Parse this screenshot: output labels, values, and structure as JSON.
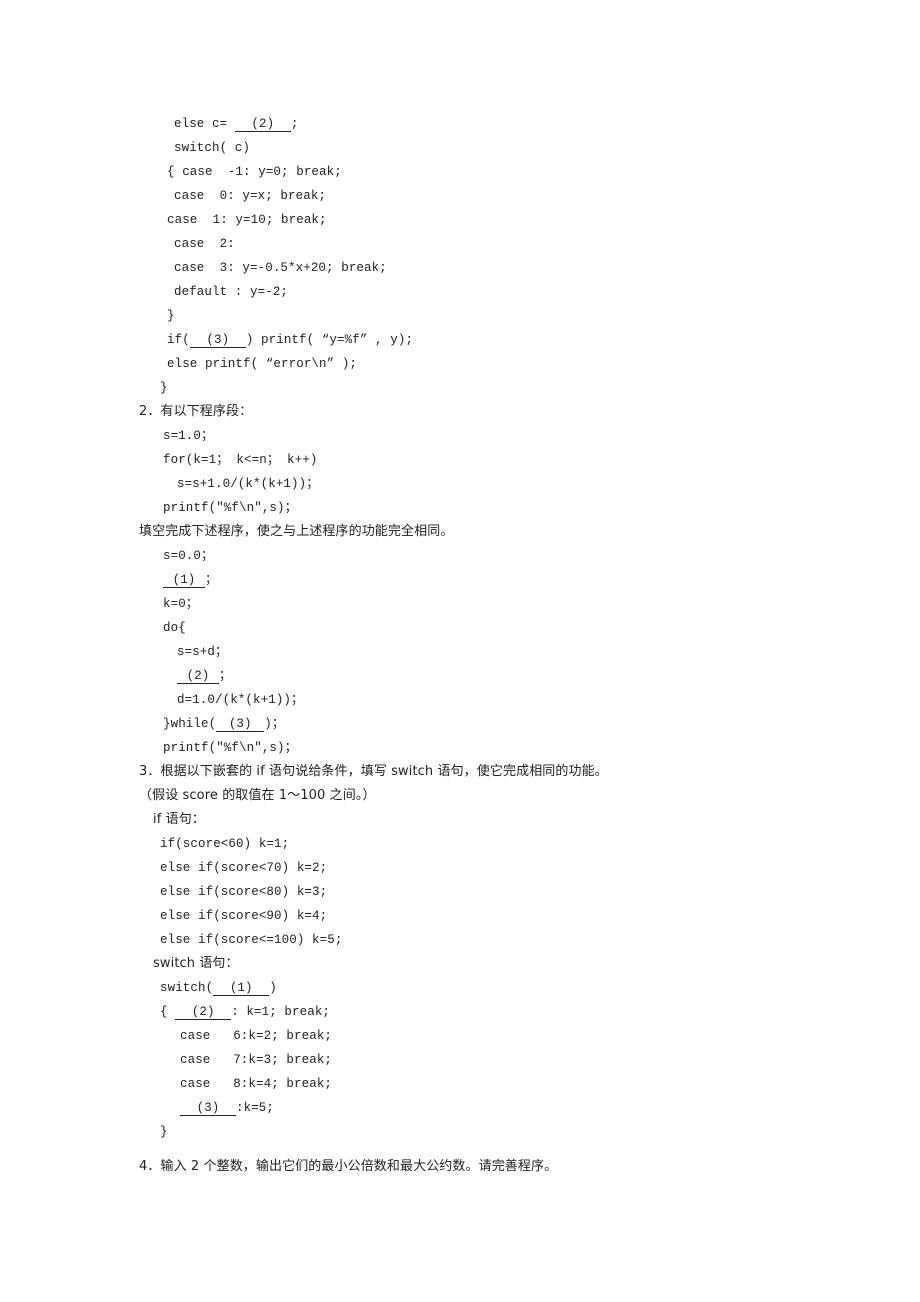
{
  "q1_tail": {
    "l1_pre": "else c= ",
    "l1_blank": "(2)",
    "l1_post": ";",
    "l2": "switch( c)",
    "l3": "{ case  -1: y=0; break;",
    "l4": "case  0: y=x; break;",
    "l5": "case  1: y=10; break;",
    "l6": "case  2:",
    "l7": "case  3: y=-0.5*x+20; break;",
    "l8": "default : y=-2;",
    "l9": "}",
    "l10_pre": "if(",
    "l10_blank": "(3)",
    "l10_post": ") printf( “y=%f” , y);",
    "l11": "else printf( “error\\n” );",
    "l12": "}"
  },
  "q2": {
    "title": "2．有以下程序段：",
    "orig": [
      "s=1.0；",
      "for(k=1； k<=n； k++)",
      "s=s+1.0/(k*(k+1))；",
      "printf(\"%f\\n\",s)；"
    ],
    "instruction": "填空完成下述程序，使之与上述程序的功能完全相同。",
    "s0": "s=0.0；",
    "b1": "(1)",
    "semi": "；",
    "k0": "k=0；",
    "do": "do{",
    "ssd": "s=s+d；",
    "b2": "(2)",
    "dline": "d=1.0/(k*(k+1))；",
    "while_pre": "}while(",
    "b3": "(3)",
    "while_post": ")；",
    "printf": "printf(\"%f\\n\",s)；"
  },
  "q3": {
    "title": "3．根据以下嵌套的 if 语句说给条件，填写 switch 语句，使它完成相同的功能。",
    "note": "（假设 score 的取值在 1～100 之间。）",
    "if_label": "if 语句：",
    "if_lines": [
      "if(score<60) k=1;",
      "else if(score<70) k=2;",
      "else if(score<80) k=3;",
      "else if(score<90) k=4;",
      "else if(score<=100) k=5;"
    ],
    "switch_label": "switch 语句：",
    "sw_pre": "switch(",
    "sw_b1": "(1)",
    "sw_post": ")",
    "brace_open": "{ ",
    "sw_b2": "(2)",
    "sw_b2_post": ": k=1; break;",
    "case_lines": [
      "case   6:k=2; break;",
      "case   7:k=3; break;",
      "case   8:k=4; break;"
    ],
    "sw_b3": "(3)",
    "sw_b3_post": ":k=5;",
    "brace_close": "}"
  },
  "q4": {
    "title": "4．输入 2 个整数，输出它们的最小公倍数和最大公约数。请完善程序。"
  }
}
